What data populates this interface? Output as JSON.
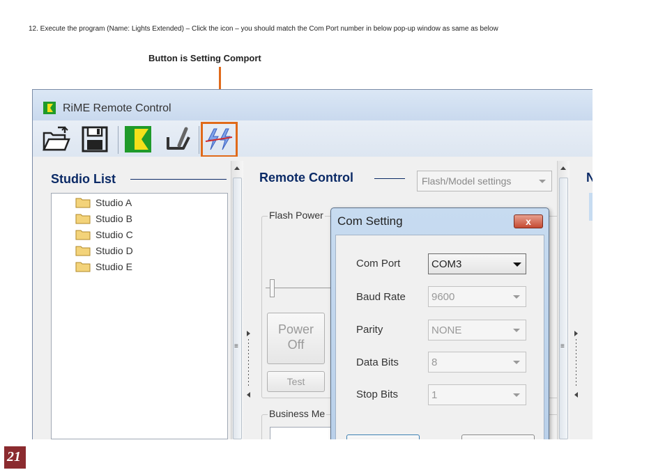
{
  "document": {
    "instruction": "12. Execute the program (Name: Lights Extended) – Click the icon – you should match the Com Port number in below pop-up window as same as below",
    "callout": "Button is Setting Comport",
    "page_number": "21"
  },
  "app": {
    "title": "RiME Remote Control",
    "toolbar": [
      "open-folder-icon",
      "save-disk-icon",
      "rime-logo-icon",
      "tool-icon",
      "comport-setting-icon"
    ],
    "colors": {
      "accent": "#e06a1a",
      "heading": "#0b2a66",
      "logo_green": "#1f9a2a",
      "logo_yellow": "#f4e01a"
    }
  },
  "studio_list": {
    "title": "Studio List",
    "items": [
      "Studio A",
      "Studio B",
      "Studio C",
      "Studio D",
      "Studio E"
    ]
  },
  "remote_control": {
    "title": "Remote Control",
    "mode_select": "Flash/Model settings",
    "flash_power_label": "Flash Power",
    "power_button": {
      "line1": "Power",
      "line2": "Off"
    },
    "test_button": "Test",
    "business_label": "Business Me"
  },
  "right_panel": {
    "title_fragment": "N"
  },
  "com_setting": {
    "title": "Com Setting",
    "close": "x",
    "fields": [
      {
        "label": "Com Port",
        "value": "COM3"
      },
      {
        "label": "Baud Rate",
        "value": "9600"
      },
      {
        "label": "Parity",
        "value": "NONE"
      },
      {
        "label": "Data Bits",
        "value": "8"
      },
      {
        "label": "Stop Bits",
        "value": "1"
      }
    ]
  }
}
